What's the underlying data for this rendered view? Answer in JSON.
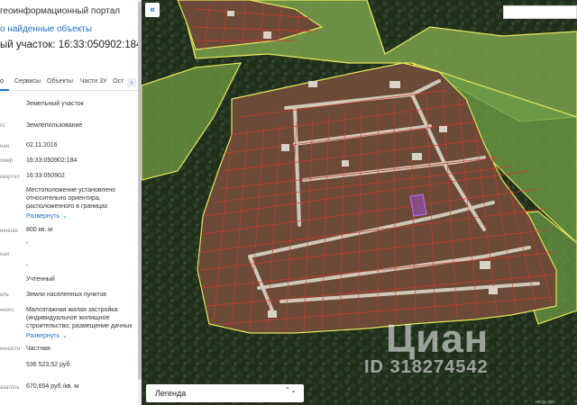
{
  "panel": {
    "portal_title": "геоинформационный портал",
    "back_link": "о найденные объекты",
    "parcel_title": "ый участок: 16:33:050902:184",
    "tabs": [
      "о",
      "Сервисы",
      "Объекты",
      "Части ЗУ",
      "Ост"
    ],
    "tab_next": "›",
    "rows": [
      {
        "label": "",
        "value": "Земельный участок"
      },
      {
        "label": "го",
        "value": "Землепользование"
      },
      {
        "label": "ная",
        "value": "02.11.2016"
      },
      {
        "label": "омер",
        "value": "16:33:050902:184"
      },
      {
        "label": "квартал",
        "value": "16:33:050902"
      },
      {
        "label": "",
        "value": "Местоположение установлено относительно ориентира, расположенного в границах"
      },
      {
        "label": "ненная",
        "value": "800 кв. м"
      },
      {
        "label": "ная",
        "value": "-"
      },
      {
        "label": "",
        "value": "-"
      },
      {
        "label": "",
        "value": "Учтенный"
      },
      {
        "label": "ель",
        "value": "Земли населенных пунктов"
      },
      {
        "label": "нного",
        "value": "Малоэтажная жилая застройка (индивидуальное жилищное строительство; размещение дачных"
      },
      {
        "label": "енности",
        "value": "Частная"
      },
      {
        "label": "",
        "value": "536 523,52 руб."
      },
      {
        "label": "азатель",
        "value": "670,654 руб./кв. м"
      }
    ],
    "expand_label": "Развернуть",
    "expand_chevron": "⌄"
  },
  "map": {
    "collapse_icon": "«",
    "legend_label": "Легенда",
    "legend_arrows": "⌃⌄",
    "watermark": "Циан",
    "watermark_id": "ID 318274542",
    "attribution": "НСПД 2023"
  },
  "colors": {
    "accent": "#1f6fc5",
    "cadastral_red": "#d9362b",
    "zone_yellow": "#e5e85a",
    "forest": "#1e2e1a"
  }
}
